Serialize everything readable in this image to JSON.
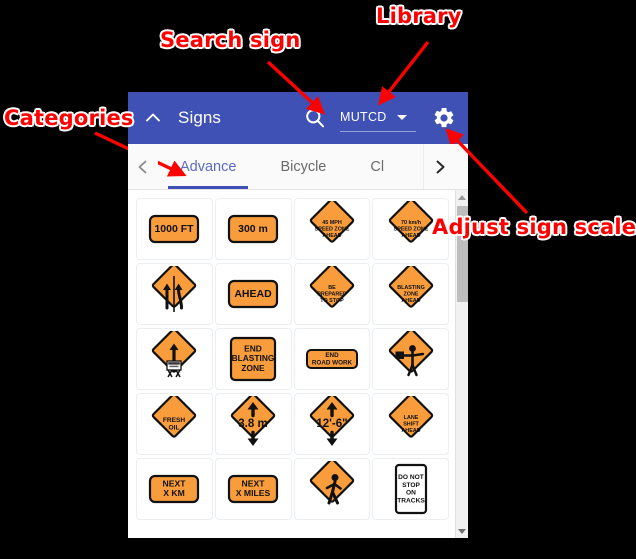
{
  "panel": {
    "title": "Signs",
    "collapse_icon": "chevron-up-icon",
    "search_icon": "search-icon",
    "library": {
      "value": "MUTCD",
      "caret_icon": "chevron-down-icon"
    },
    "settings_icon": "gear-icon",
    "header_color": "#3f51b5"
  },
  "tabs": {
    "prev_icon": "chevron-left-icon",
    "next_icon": "chevron-right-icon",
    "items": [
      {
        "label": "Advance",
        "active": true
      },
      {
        "label": "Bicycle",
        "active": false
      },
      {
        "label": "Cl",
        "active": false
      }
    ],
    "active_color": "#3f51b5"
  },
  "scrollbar": {
    "up_icon": "triangle-up-icon",
    "down_icon": "triangle-down-icon"
  },
  "signs": {
    "sign_orange": "#f89c3c",
    "items": [
      {
        "name": "1000-ft",
        "shape": "rect",
        "lines": [
          "1000 FT"
        ]
      },
      {
        "name": "300-m",
        "shape": "rect",
        "lines": [
          "300 m"
        ]
      },
      {
        "name": "45-mph-speed-zone-ahead",
        "shape": "diamond",
        "lines": [
          "45 MPH",
          "SPEED ZONE",
          "AHEAD"
        ]
      },
      {
        "name": "70-kmh-speed-zone-ahead",
        "shape": "diamond",
        "lines": [
          "70 km/h",
          "SPEED ZONE",
          "AHEAD"
        ]
      },
      {
        "name": "added-lane-merge",
        "shape": "diamond",
        "lines": [],
        "glyph": "merge-arrows"
      },
      {
        "name": "ahead",
        "shape": "rect",
        "lines": [
          "AHEAD"
        ]
      },
      {
        "name": "be-prepared-to-stop",
        "shape": "diamond",
        "lines": [
          "BE",
          "PREPARED",
          "TO STOP"
        ]
      },
      {
        "name": "blasting-zone-ahead",
        "shape": "diamond",
        "lines": [
          "BLASTING",
          "ZONE",
          "AHEAD"
        ]
      },
      {
        "name": "survey-crew",
        "shape": "diamond",
        "lines": [],
        "glyph": "survey-crew"
      },
      {
        "name": "end-blasting-zone",
        "shape": "square",
        "lines": [
          "END",
          "BLASTING",
          "ZONE"
        ]
      },
      {
        "name": "end-road-work",
        "shape": "rect-wide",
        "lines": [
          "END",
          "ROAD WORK"
        ]
      },
      {
        "name": "flagger-ahead",
        "shape": "diamond",
        "lines": [],
        "glyph": "flagger"
      },
      {
        "name": "fresh-oil",
        "shape": "diamond",
        "lines": [
          "FRESH",
          "OIL"
        ]
      },
      {
        "name": "low-clearance-3-8m",
        "shape": "diamond",
        "lines": [
          "3.8 m"
        ],
        "glyph": "clearance"
      },
      {
        "name": "low-clearance-12-6",
        "shape": "diamond",
        "lines": [
          "12'-6\""
        ],
        "glyph": "clearance"
      },
      {
        "name": "lane-shift-ahead",
        "shape": "diamond",
        "lines": [
          "LANE",
          "SHIFT",
          "AHEAD"
        ]
      },
      {
        "name": "next-x-km",
        "shape": "rect",
        "lines": [
          "NEXT",
          "X KM"
        ]
      },
      {
        "name": "next-x-miles",
        "shape": "rect",
        "lines": [
          "NEXT",
          "X MILES"
        ]
      },
      {
        "name": "pedestrian-crossing",
        "shape": "diamond",
        "lines": [],
        "glyph": "pedestrian"
      },
      {
        "name": "do-not-stop-on-tracks",
        "shape": "vertical-white",
        "lines": [
          "DO NOT",
          "STOP",
          "ON",
          "TRACKS"
        ]
      }
    ]
  },
  "annotations": {
    "categories": "Categories",
    "search": "Search sign",
    "library": "Library",
    "scale": "Adjust sign scale",
    "color": "#ff0000"
  }
}
